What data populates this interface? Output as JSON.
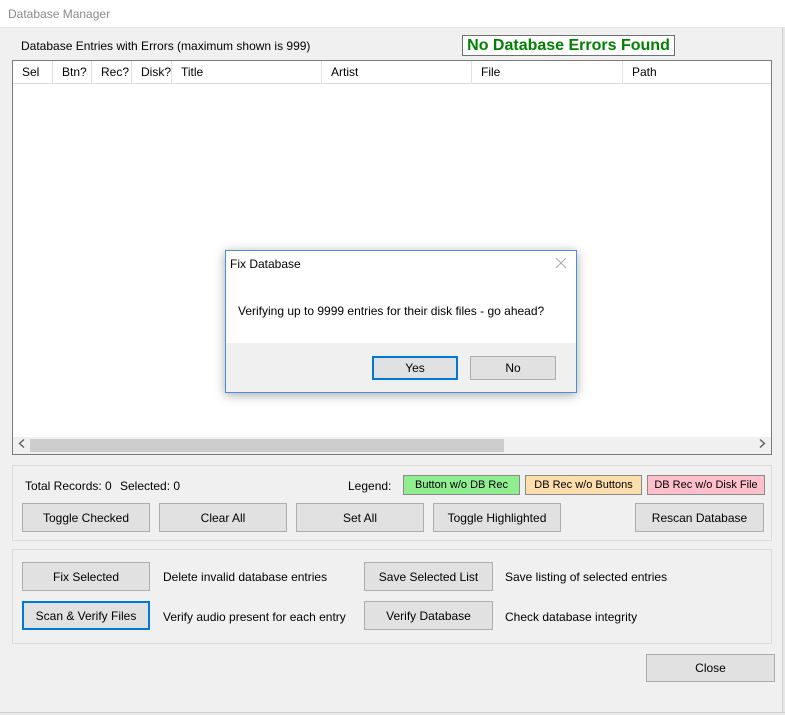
{
  "window": {
    "title": "Database Manager"
  },
  "header": {
    "entries_label": "Database Entries with Errors (maximum shown is 999)",
    "status_text": "No Database Errors Found",
    "status_color": "#008000"
  },
  "grid": {
    "columns": [
      {
        "label": "Sel"
      },
      {
        "label": "Btn?"
      },
      {
        "label": "Rec?"
      },
      {
        "label": "Disk?"
      },
      {
        "label": "Title"
      },
      {
        "label": "Artist"
      },
      {
        "label": "File"
      },
      {
        "label": "Path"
      }
    ],
    "rows": [],
    "scroll_left_icon": "chevron-left-icon",
    "scroll_right_icon": "chevron-right-icon"
  },
  "summary": {
    "total_records_label": "Total Records: 0",
    "selected_label": "Selected: 0",
    "legend_label": "Legend:",
    "legend": [
      {
        "label": "Button w/o DB Rec",
        "color": "#90ee90"
      },
      {
        "label": "DB Rec w/o Buttons",
        "color": "#ffdead"
      },
      {
        "label": "DB Rec w/o Disk File",
        "color": "#ffc0cb"
      }
    ]
  },
  "selection_buttons": {
    "toggle_checked": "Toggle Checked",
    "clear_all": "Clear All",
    "set_all": "Set All",
    "toggle_highlighted": "Toggle Highlighted",
    "rescan_database": "Rescan Database"
  },
  "actions": {
    "fix_selected": "Fix Selected",
    "fix_selected_desc": "Delete invalid database entries",
    "save_selected_list": "Save Selected List",
    "save_selected_list_desc": "Save listing of selected entries",
    "scan_verify": "Scan & Verify Files",
    "scan_verify_desc": "Verify audio present for each entry",
    "verify_database": "Verify Database",
    "verify_database_desc": "Check database integrity"
  },
  "close_button": "Close",
  "dialog": {
    "title": "Fix Database",
    "message": "Verifying up to 9999 entries for their disk files - go ahead?",
    "yes_label": "Yes",
    "no_label": "No",
    "close_icon": "close-icon"
  }
}
